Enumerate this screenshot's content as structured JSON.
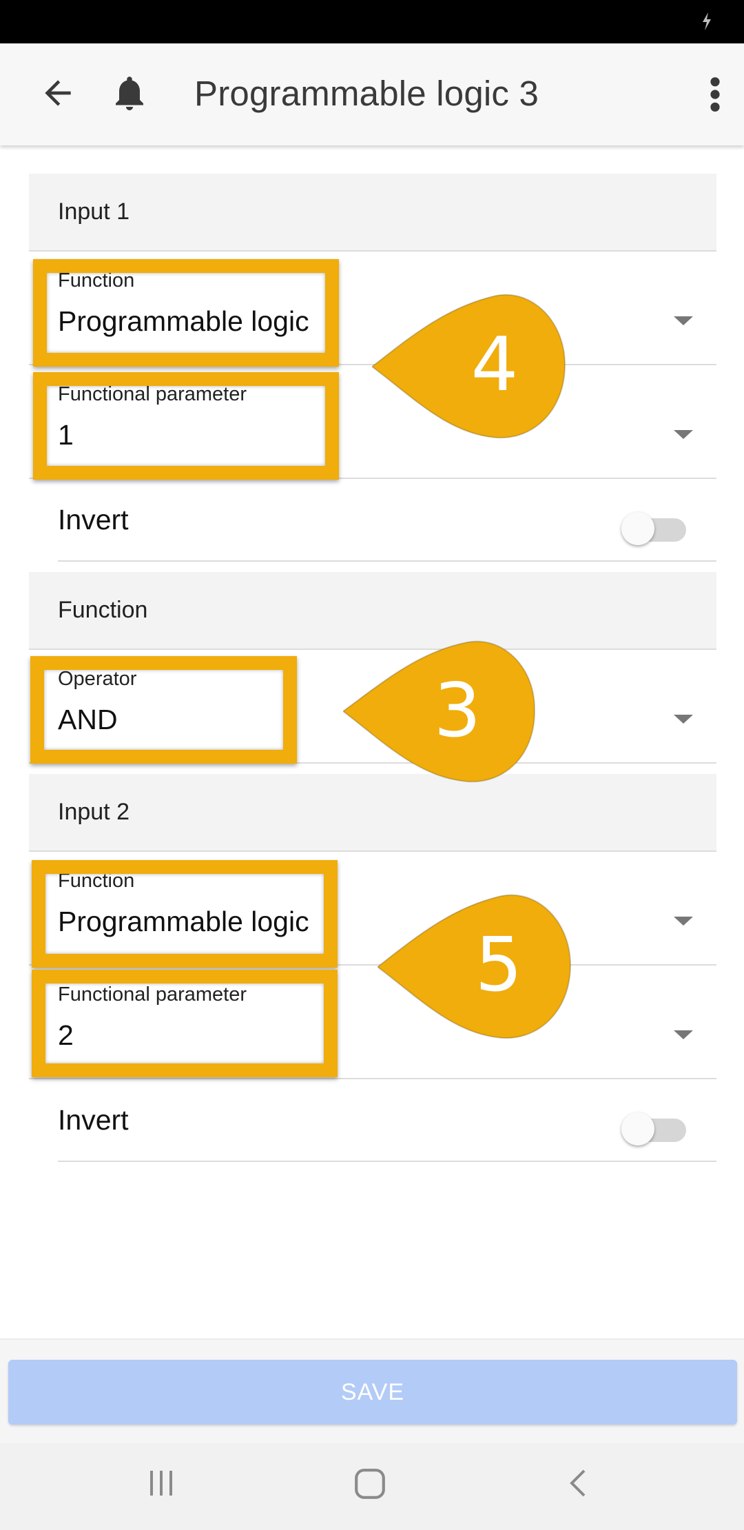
{
  "app": {
    "title": "Programmable logic 3"
  },
  "input1": {
    "header": "Input 1",
    "function": {
      "label": "Function",
      "value": "Programmable logic"
    },
    "parameter": {
      "label": "Functional parameter",
      "value": "1"
    },
    "invert": {
      "label": "Invert",
      "on": false
    }
  },
  "function_section": {
    "header": "Function",
    "operator": {
      "label": "Operator",
      "value": "AND"
    }
  },
  "input2": {
    "header": "Input 2",
    "function": {
      "label": "Function",
      "value": "Programmable logic"
    },
    "parameter": {
      "label": "Functional parameter",
      "value": "2"
    },
    "invert": {
      "label": "Invert",
      "on": false
    }
  },
  "callouts": {
    "first": "4",
    "second": "3",
    "third": "5"
  },
  "actions": {
    "save_label": "SAVE"
  },
  "colors": {
    "highlight": "#f0ad0b",
    "save_button": "#b3cbf7",
    "header_bg": "#f3f3f3"
  },
  "icons": [
    "back-arrow-icon",
    "bell-icon",
    "more-vert-icon",
    "dropdown-arrow-icon",
    "recent-apps-icon",
    "home-icon",
    "nav-back-icon"
  ]
}
